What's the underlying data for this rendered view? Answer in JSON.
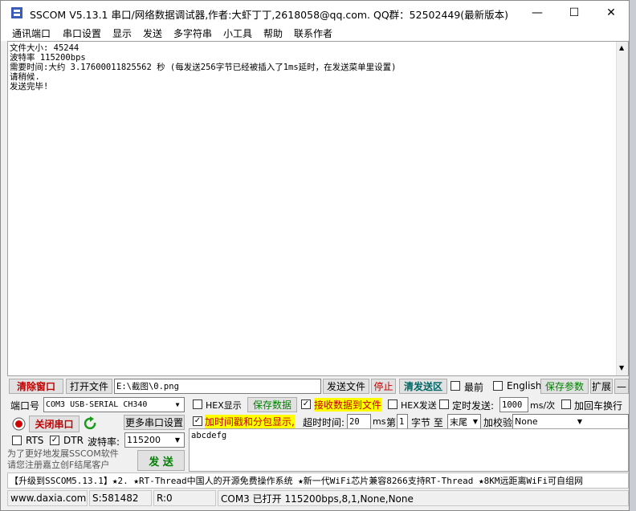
{
  "title": {
    "app_title": "SSCOM V5.13.1 串口/网络数据调试器,作者:大虾丁丁,2618058@qq.com. QQ群：52502449(最新版本)",
    "minimize_glyph": "—",
    "maximize_glyph": "☐",
    "close_glyph": "✕"
  },
  "menu": [
    "通讯端口",
    "串口设置",
    "显示",
    "发送",
    "多字符串",
    "小工具",
    "帮助",
    "联系作者"
  ],
  "receive": {
    "lines": [
      "文件大小: 45244",
      "波特率 115200bps",
      "需要时间:大约 3.17600011825562 秒 (每发送256字节已经被插入了1ms延时，在发送菜单里设置)",
      "请稍候.",
      "发送完毕!"
    ]
  },
  "toolbar1": {
    "clear_window": "清除窗口",
    "open_file": "打开文件",
    "file_path": "E:\\截图\\0.png",
    "send_file": "发送文件",
    "stop": "停止",
    "clear_send": "清发送区",
    "topmost": "最前",
    "english": "English",
    "save_params": "保存参数",
    "expand": "扩展",
    "collapse_glyph": "—"
  },
  "row2": {
    "port_label": "端口号",
    "port_value": "COM3 USB-SERIAL CH340",
    "hex_display": "HEX显示",
    "save_data": "保存数据",
    "recv_to_file": "接收数据到文件",
    "hex_send": "HEX发送",
    "timed_send": "定时发送:",
    "interval": "1000",
    "interval_unit": "ms/次",
    "add_crlf": "加回车换行"
  },
  "row3": {
    "close_port": "关闭串口",
    "more_settings": "更多串口设置",
    "timestamp_label": "加时间戳和分包显示,",
    "timeout_label": "超时时间:",
    "timeout_value": "20",
    "timeout_unit": "ms",
    "nth_label": "第",
    "nth_value": "1",
    "byte_label": "字节 至",
    "end_value": "末尾",
    "checksum_label": "加校验",
    "checksum_value": "None"
  },
  "row4": {
    "rts": "RTS",
    "dtr": "DTR",
    "baud_label": "波特率:",
    "baud_value": "115200"
  },
  "send": {
    "text": "abcdefg",
    "button": "发 送"
  },
  "promo": [
    "为了更好地发展SSCOM软件",
    "请您注册嘉立创F结尾客户"
  ],
  "ad_text": "【升级到SSCOM5.13.1】★2. ★RT-Thread中国人的开源免费操作系统 ★新一代WiFi芯片兼容8266支持RT-Thread ★8KM远距离WiFi可自组网",
  "status": {
    "website": "www.daxia.com",
    "sent": "S:581482",
    "received": "R:0",
    "port_status": "COM3 已打开  115200bps,8,1,None,None"
  },
  "colors": {
    "highlight": "#ffff00",
    "red_text": "#c00000",
    "green_text": "#008000"
  }
}
